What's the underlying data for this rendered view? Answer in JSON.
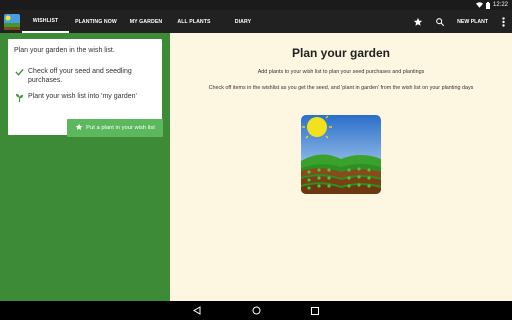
{
  "status_bar": {
    "time": "12:22"
  },
  "tabs": [
    {
      "label": "WISHLIST",
      "active": true
    },
    {
      "label": "PLANTING NOW",
      "active": false
    },
    {
      "label": "MY GARDEN",
      "active": false
    },
    {
      "label": "ALL PLANTS",
      "active": false
    },
    {
      "label": "DIARY",
      "active": false
    }
  ],
  "actions": {
    "new_plant_label": "NEW PLANT"
  },
  "sidebar": {
    "title": "Plan your garden in the wish list.",
    "row1": {
      "line1": "Check off your seed and seedling",
      "line2": "purchases."
    },
    "row2": {
      "text": "Plant your wish list into 'my garden'"
    },
    "button_label": "Put a plant in your wish list"
  },
  "main": {
    "title": "Plan your garden",
    "line1": "Add plants to your wish list to plan your seed purchases and plantings",
    "line2": "Check off items in the wishlist as you get the seed, and 'plant in garden' from the wish list on your planting days"
  },
  "colors": {
    "app_bar": "#212121",
    "sidebar_green": "#3d8b37",
    "button_green": "#5cb85c",
    "main_bg": "#fdf6e1"
  },
  "icons": [
    "app-logo-icon",
    "star-icon",
    "search-icon",
    "more-vert-icon",
    "check-icon",
    "sprout-icon",
    "back-icon",
    "home-icon",
    "recents-icon",
    "wifi-icon",
    "battery-icon"
  ]
}
